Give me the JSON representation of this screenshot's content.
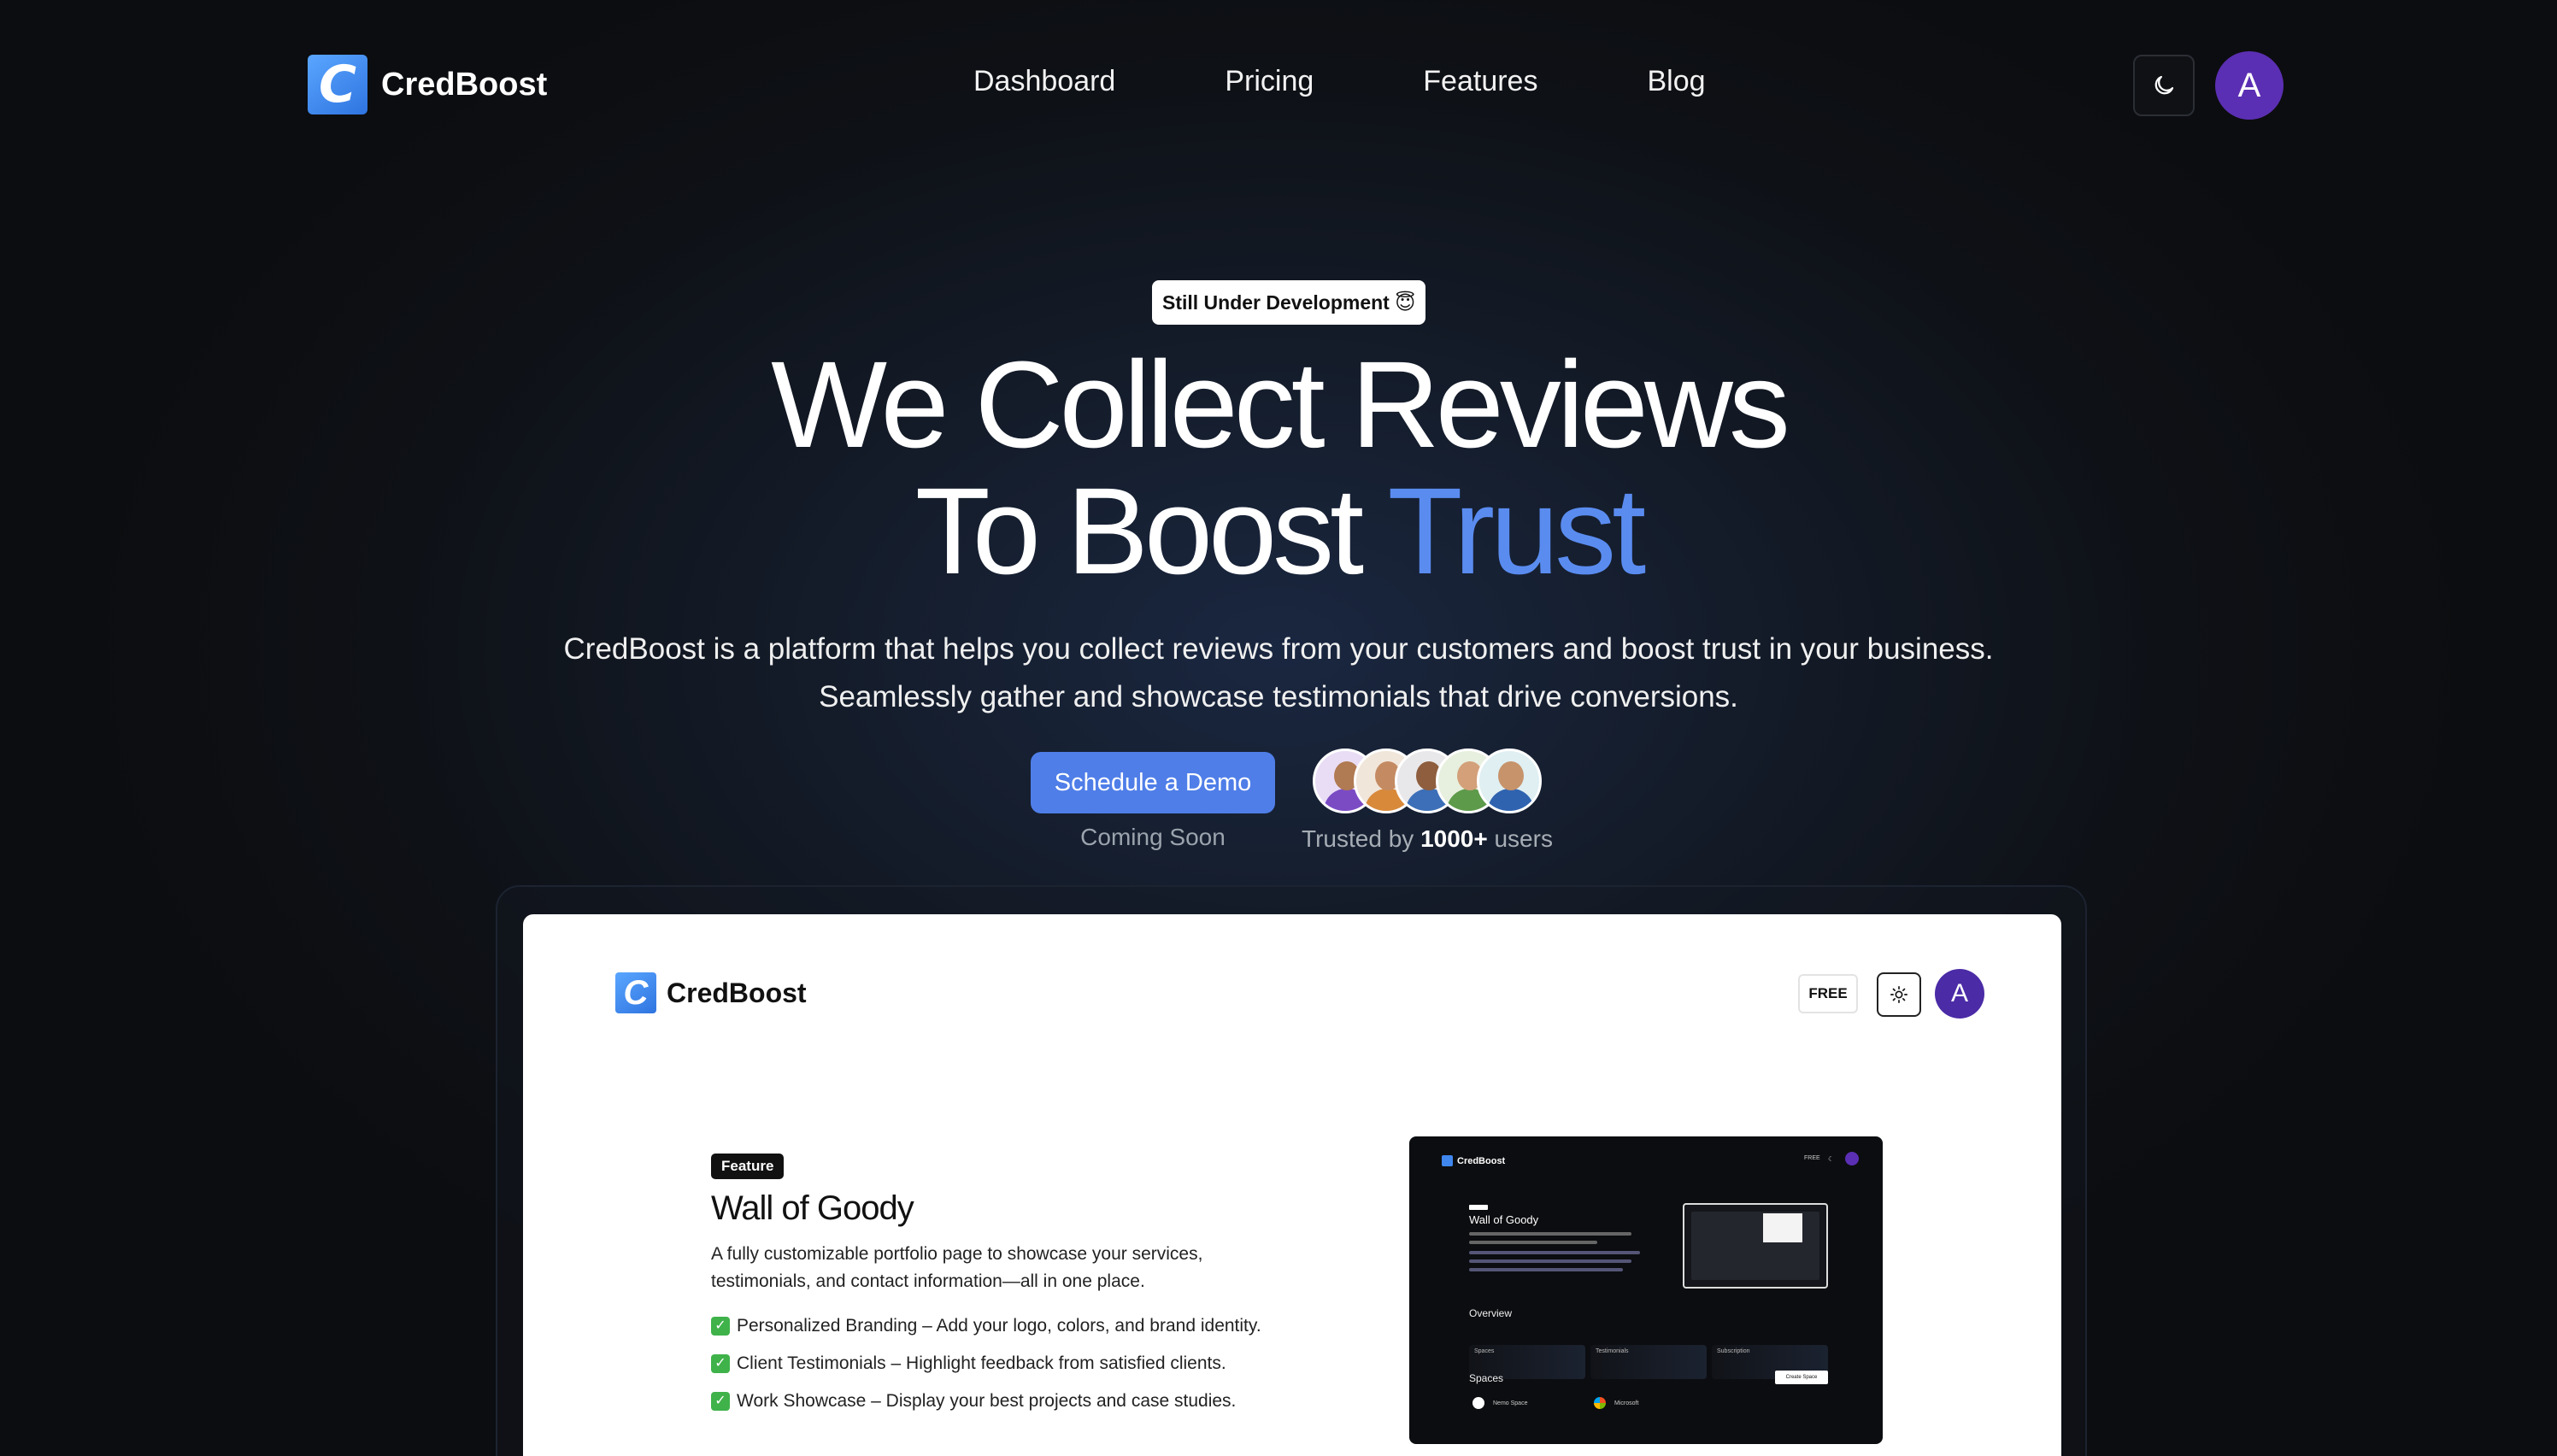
{
  "header": {
    "brand": "CredBoost",
    "logo_letter": "C",
    "nav": [
      "Dashboard",
      "Pricing",
      "Features",
      "Blog"
    ],
    "avatar_initial": "A"
  },
  "hero": {
    "badge": "Still Under Development 😇",
    "title_line1": "We Collect Reviews",
    "title_line2_plain": "To Boost ",
    "title_line2_accent": "Trust",
    "subtitle_line1": "CredBoost is a platform that helps you collect reviews from your customers and boost trust in your business.",
    "subtitle_line2": "Seamlessly gather and showcase testimonials that drive conversions.",
    "cta_label": "Schedule a Demo",
    "cta_note": "Coming Soon",
    "trusted_prefix": "Trusted by ",
    "trusted_count": "1000+",
    "trusted_suffix": " users"
  },
  "preview": {
    "brand": "CredBoost",
    "logo_letter": "C",
    "plan_badge": "FREE",
    "avatar_initial": "A",
    "feature_tag": "Feature",
    "feature_title": "Wall of Goody",
    "feature_desc_line1": "A fully customizable portfolio page to showcase your services,",
    "feature_desc_line2": "testimonials, and contact information—all in one place.",
    "feature_items": [
      "Personalized Branding – Add your logo, colors, and brand identity.",
      "Client Testimonials – Highlight feedback from satisfied clients.",
      "Work Showcase – Display your best projects and case studies."
    ],
    "mini": {
      "brand": "CredBoost",
      "free": "FREE",
      "title": "Wall of Goody",
      "overview": "Overview",
      "stats": [
        "Spaces",
        "Testimonials",
        "Subscription"
      ],
      "spaces": "Spaces",
      "create_btn": "Create Space",
      "rows": [
        "Nemo Space",
        "Microsoft"
      ]
    }
  },
  "colors": {
    "accent": "#5a8cf0",
    "cta": "#4f7ee8",
    "avatar": "#5b2fb3",
    "logo": "#3f86ee",
    "check": "#3fb24a"
  }
}
